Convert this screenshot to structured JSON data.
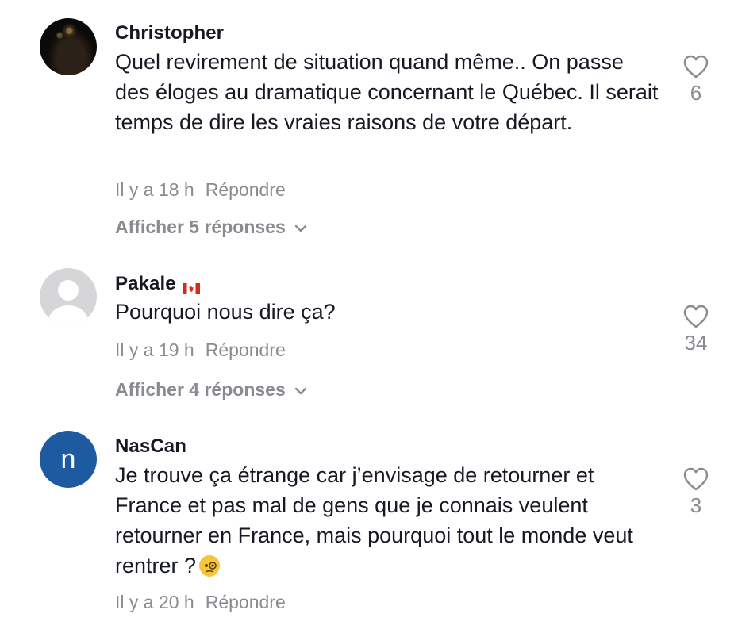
{
  "comments": [
    {
      "username": "Christopher",
      "text": "Quel revirement de situation quand même.. On passe des éloges au dramatique concernant le Québec. Il serait temps de dire les vraies raisons de votre départ.",
      "time": "Il y a 18 h",
      "reply_label": "Répondre",
      "view_replies": "Afficher 5 réponses",
      "likes": "6"
    },
    {
      "username": "Pakale",
      "text": "Pourquoi nous dire ça?",
      "time": "Il y a 19 h",
      "reply_label": "Répondre",
      "view_replies": "Afficher 4 réponses",
      "likes": "34"
    },
    {
      "username": "NasCan",
      "avatar_letter": "n",
      "text": "Je trouve ça étrange car j’envisage de retourner et France et pas mal de gens que je connais veulent retourner en France, mais pourquoi tout le monde veut rentrer ?",
      "time": "Il y a 20 h",
      "reply_label": "Répondre",
      "likes": "3"
    }
  ],
  "icons": {
    "like": "heart-outline-icon",
    "expand": "chevron-down-icon",
    "flag": "canada-flag-icon",
    "emoji": "face-with-monocle-icon"
  },
  "colors": {
    "text": "#161823",
    "muted": "#8a8b91",
    "avatar_n": "#1d5aa0"
  }
}
